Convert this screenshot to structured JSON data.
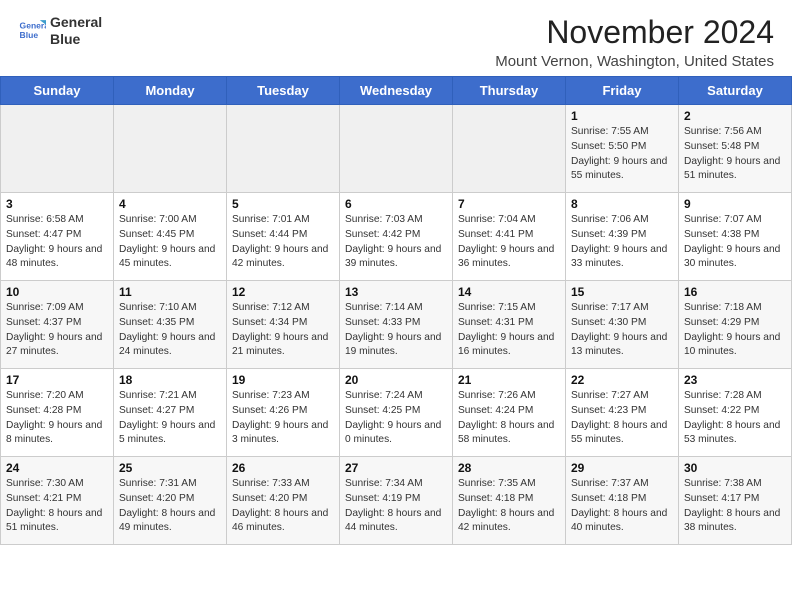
{
  "logo": {
    "line1": "General",
    "line2": "Blue"
  },
  "title": "November 2024",
  "location": "Mount Vernon, Washington, United States",
  "days_of_week": [
    "Sunday",
    "Monday",
    "Tuesday",
    "Wednesday",
    "Thursday",
    "Friday",
    "Saturday"
  ],
  "weeks": [
    [
      {
        "day": "",
        "info": ""
      },
      {
        "day": "",
        "info": ""
      },
      {
        "day": "",
        "info": ""
      },
      {
        "day": "",
        "info": ""
      },
      {
        "day": "",
        "info": ""
      },
      {
        "day": "1",
        "info": "Sunrise: 7:55 AM\nSunset: 5:50 PM\nDaylight: 9 hours and 55 minutes."
      },
      {
        "day": "2",
        "info": "Sunrise: 7:56 AM\nSunset: 5:48 PM\nDaylight: 9 hours and 51 minutes."
      }
    ],
    [
      {
        "day": "3",
        "info": "Sunrise: 6:58 AM\nSunset: 4:47 PM\nDaylight: 9 hours and 48 minutes."
      },
      {
        "day": "4",
        "info": "Sunrise: 7:00 AM\nSunset: 4:45 PM\nDaylight: 9 hours and 45 minutes."
      },
      {
        "day": "5",
        "info": "Sunrise: 7:01 AM\nSunset: 4:44 PM\nDaylight: 9 hours and 42 minutes."
      },
      {
        "day": "6",
        "info": "Sunrise: 7:03 AM\nSunset: 4:42 PM\nDaylight: 9 hours and 39 minutes."
      },
      {
        "day": "7",
        "info": "Sunrise: 7:04 AM\nSunset: 4:41 PM\nDaylight: 9 hours and 36 minutes."
      },
      {
        "day": "8",
        "info": "Sunrise: 7:06 AM\nSunset: 4:39 PM\nDaylight: 9 hours and 33 minutes."
      },
      {
        "day": "9",
        "info": "Sunrise: 7:07 AM\nSunset: 4:38 PM\nDaylight: 9 hours and 30 minutes."
      }
    ],
    [
      {
        "day": "10",
        "info": "Sunrise: 7:09 AM\nSunset: 4:37 PM\nDaylight: 9 hours and 27 minutes."
      },
      {
        "day": "11",
        "info": "Sunrise: 7:10 AM\nSunset: 4:35 PM\nDaylight: 9 hours and 24 minutes."
      },
      {
        "day": "12",
        "info": "Sunrise: 7:12 AM\nSunset: 4:34 PM\nDaylight: 9 hours and 21 minutes."
      },
      {
        "day": "13",
        "info": "Sunrise: 7:14 AM\nSunset: 4:33 PM\nDaylight: 9 hours and 19 minutes."
      },
      {
        "day": "14",
        "info": "Sunrise: 7:15 AM\nSunset: 4:31 PM\nDaylight: 9 hours and 16 minutes."
      },
      {
        "day": "15",
        "info": "Sunrise: 7:17 AM\nSunset: 4:30 PM\nDaylight: 9 hours and 13 minutes."
      },
      {
        "day": "16",
        "info": "Sunrise: 7:18 AM\nSunset: 4:29 PM\nDaylight: 9 hours and 10 minutes."
      }
    ],
    [
      {
        "day": "17",
        "info": "Sunrise: 7:20 AM\nSunset: 4:28 PM\nDaylight: 9 hours and 8 minutes."
      },
      {
        "day": "18",
        "info": "Sunrise: 7:21 AM\nSunset: 4:27 PM\nDaylight: 9 hours and 5 minutes."
      },
      {
        "day": "19",
        "info": "Sunrise: 7:23 AM\nSunset: 4:26 PM\nDaylight: 9 hours and 3 minutes."
      },
      {
        "day": "20",
        "info": "Sunrise: 7:24 AM\nSunset: 4:25 PM\nDaylight: 9 hours and 0 minutes."
      },
      {
        "day": "21",
        "info": "Sunrise: 7:26 AM\nSunset: 4:24 PM\nDaylight: 8 hours and 58 minutes."
      },
      {
        "day": "22",
        "info": "Sunrise: 7:27 AM\nSunset: 4:23 PM\nDaylight: 8 hours and 55 minutes."
      },
      {
        "day": "23",
        "info": "Sunrise: 7:28 AM\nSunset: 4:22 PM\nDaylight: 8 hours and 53 minutes."
      }
    ],
    [
      {
        "day": "24",
        "info": "Sunrise: 7:30 AM\nSunset: 4:21 PM\nDaylight: 8 hours and 51 minutes."
      },
      {
        "day": "25",
        "info": "Sunrise: 7:31 AM\nSunset: 4:20 PM\nDaylight: 8 hours and 49 minutes."
      },
      {
        "day": "26",
        "info": "Sunrise: 7:33 AM\nSunset: 4:20 PM\nDaylight: 8 hours and 46 minutes."
      },
      {
        "day": "27",
        "info": "Sunrise: 7:34 AM\nSunset: 4:19 PM\nDaylight: 8 hours and 44 minutes."
      },
      {
        "day": "28",
        "info": "Sunrise: 7:35 AM\nSunset: 4:18 PM\nDaylight: 8 hours and 42 minutes."
      },
      {
        "day": "29",
        "info": "Sunrise: 7:37 AM\nSunset: 4:18 PM\nDaylight: 8 hours and 40 minutes."
      },
      {
        "day": "30",
        "info": "Sunrise: 7:38 AM\nSunset: 4:17 PM\nDaylight: 8 hours and 38 minutes."
      }
    ]
  ]
}
